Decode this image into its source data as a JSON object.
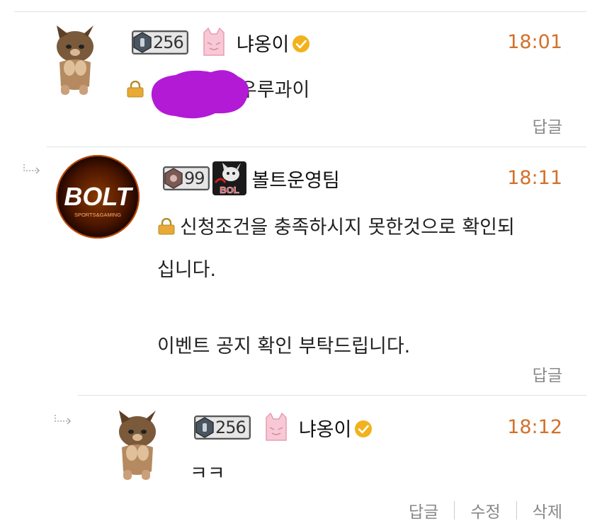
{
  "comments": [
    {
      "level": "256",
      "nickname": "냐옹이",
      "time": "18:01",
      "text_secret_visible": "우루과이",
      "actions": [
        "답글"
      ]
    },
    {
      "level": "99",
      "nickname": "볼트운영팀",
      "time": "18:11",
      "avatar_logo_text": "BOLT",
      "avatar_logo_sub": "SPORTS&GAMING",
      "text_lines": [
        "신청조건을 충족하시지 못한것으로 확인되",
        "십니다."
      ],
      "text_line3": "이벤트 공지 확인 부탁드립니다.",
      "actions": [
        "답글"
      ]
    },
    {
      "level": "256",
      "nickname": "냐옹이",
      "time": "18:12",
      "text": "ㅋㅋ",
      "actions": [
        "답글",
        "수정",
        "삭제"
      ]
    }
  ],
  "colors": {
    "time": "#d4702a",
    "redaction": "#b21ad6",
    "verified": "#f2b21c",
    "lock": "#e8a935"
  },
  "icons": [
    "reply-arrow-icon",
    "level-gem-icon",
    "verified-badge-icon",
    "lock-icon"
  ]
}
